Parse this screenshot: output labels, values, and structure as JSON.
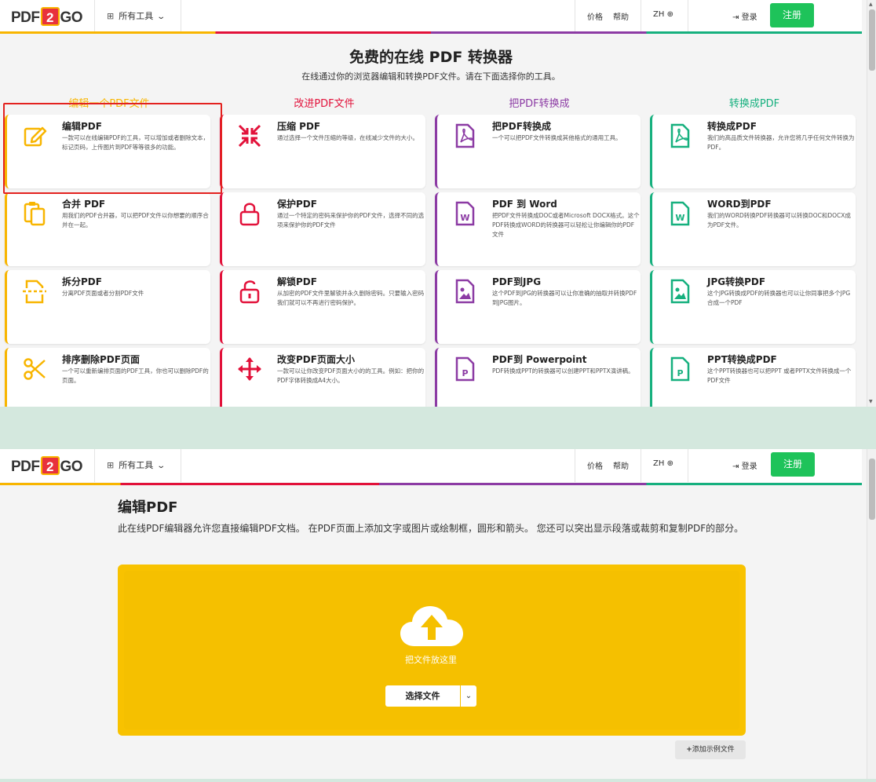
{
  "nav": {
    "logo_pre": "PDF",
    "logo_mid": "2",
    "logo_post": "GO",
    "tools_label": "所有工具",
    "pricing": "价格",
    "help": "帮助",
    "lang": "ZH",
    "login": "登录",
    "signup": "注册"
  },
  "hero": {
    "title": "免费的在线 PDF 转换器",
    "subtitle": "在线通过你的浏览器编辑和转换PDF文件。请在下面选择你的工具。"
  },
  "columns": [
    {
      "label": "编辑一个PDF文件",
      "color": "#f8b500"
    },
    {
      "label": "改进PDF文件",
      "color": "#e2113a"
    },
    {
      "label": "把PDF转换成",
      "color": "#8c3ba4"
    },
    {
      "label": "转换成PDF",
      "color": "#16b07e"
    }
  ],
  "cards": [
    {
      "title": "编辑PDF",
      "desc": "一款可以在线编辑PDF的工具，可以增加或者删除文本，标记页码，上传图片到PDF等等很多的功能。",
      "icon": "edit-icon"
    },
    {
      "title": "压缩 PDF",
      "desc": "通过选择一个文件压缩的等级，在线减少文件的大小。",
      "icon": "compress-icon"
    },
    {
      "title": "把PDF转换成",
      "desc": "一个可以把PDF文件转换成其他格式的通用工具。",
      "icon": "pdf-file-icon"
    },
    {
      "title": "转换成PDF",
      "desc": "我们的高品质文件转换器，允许您将几乎任何文件转换为PDF。",
      "icon": "pdf-file-icon"
    },
    {
      "title": "合并 PDF",
      "desc": "用我们的PDF合并器，可以把PDF文件以你想要的顺序合并在一起。",
      "icon": "merge-icon"
    },
    {
      "title": "保护PDF",
      "desc": "通过一个特定的密码来保护你的PDF文件，选择不同的选项来保护你的PDF文件",
      "icon": "lock-icon"
    },
    {
      "title": "PDF 到 Word",
      "desc": "把PDF文件转换成DOC或者Microsoft DOCX格式。这个PDF转换成WORD的转换器可以轻松让你编辑你的PDF文件",
      "icon": "word-file-icon"
    },
    {
      "title": "WORD到PDF",
      "desc": "我们的WORD转换PDF转换器可以转换DOC和DOCX成为PDF文件。",
      "icon": "word-file-icon"
    },
    {
      "title": "拆分PDF",
      "desc": "分离PDF页面或者分割PDF文件",
      "icon": "split-icon"
    },
    {
      "title": "解锁PDF",
      "desc": "从加密的PDF文件里解锁并永久删除密码。只要输入密码我们就可以不再进行密码保护。",
      "icon": "unlock-icon"
    },
    {
      "title": "PDF到JPG",
      "desc": "这个PDF到JPG的转换器可以让你准确的抽取并转换PDF到JPG图片。",
      "icon": "image-file-icon"
    },
    {
      "title": "JPG转换PDF",
      "desc": "这个JPG转换成PDF的转换器也可以让你同事把多个JPG合成一个PDF",
      "icon": "image-file-icon"
    },
    {
      "title": "排序删除PDF页面",
      "desc": "一个可以重新编排页面的PDF工具，你也可以删除PDF的页面。",
      "icon": "scissors-icon"
    },
    {
      "title": "改变PDF页面大小",
      "desc": "一款可以让你改变PDF页面大小的的工具。例如：把你的PDF字体转换成A4大小。",
      "icon": "resize-icon"
    },
    {
      "title": "PDF到 Powerpoint",
      "desc": "PDF转换成PPT的转换器可以创建PPT和PPTX演讲稿。",
      "icon": "ppt-file-icon"
    },
    {
      "title": "PPT转换成PDF",
      "desc": "这个PPT转换器也可以把PPT 或者PPTX文件转换成一个PDF文件",
      "icon": "ppt-file-icon"
    }
  ],
  "editor": {
    "title": "编辑PDF",
    "desc": "此在线PDF编辑器允许您直接编辑PDF文档。 在PDF页面上添加文字或图片或绘制框，圆形和箭头。 您还可以突出显示段落或裁剪和复制PDF的部分。",
    "drop_text": "把文件放这里",
    "choose_file": "选择文件",
    "add_example": "添加示例文件"
  }
}
